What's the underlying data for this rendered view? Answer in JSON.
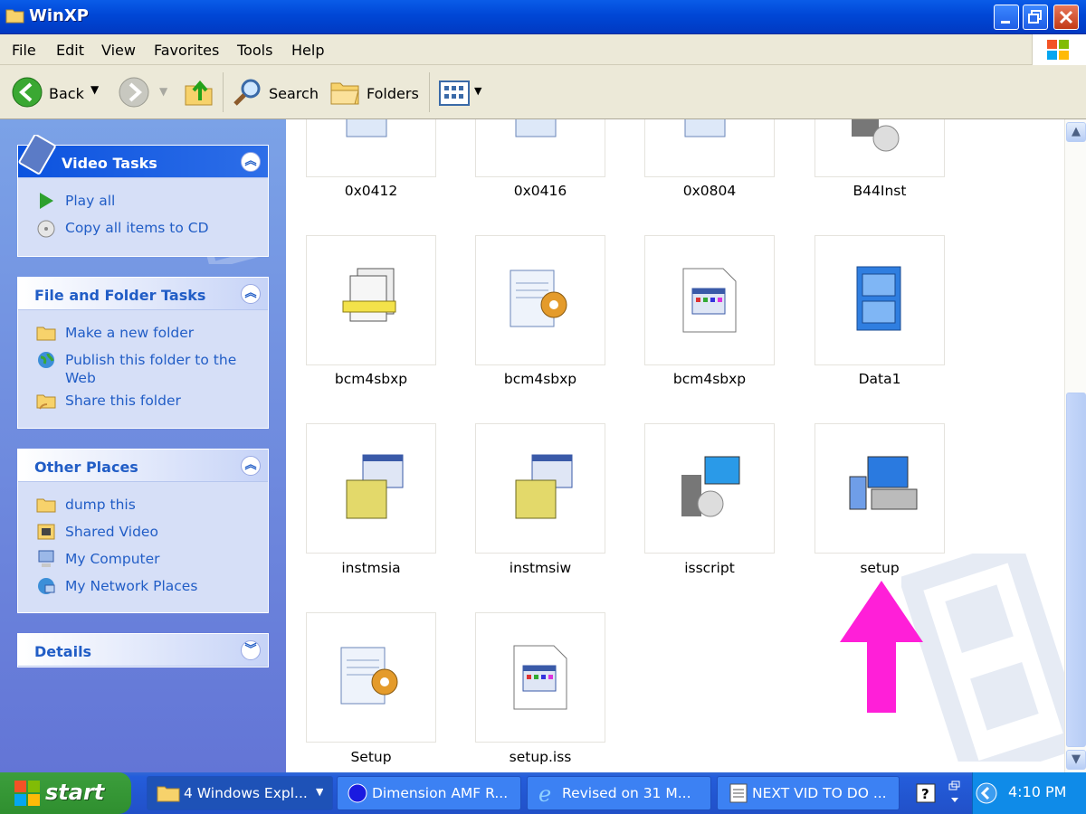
{
  "window": {
    "title": "WinXP"
  },
  "menu": [
    "File",
    "Edit",
    "View",
    "Favorites",
    "Tools",
    "Help"
  ],
  "toolbar": {
    "back": "Back",
    "search": "Search",
    "folders": "Folders"
  },
  "panels": {
    "video": {
      "title": "Video Tasks",
      "links": [
        "Play all",
        "Copy all items to CD"
      ]
    },
    "file": {
      "title": "File and Folder Tasks",
      "links": [
        "Make a new folder",
        "Publish this folder to the Web",
        "Share this folder"
      ]
    },
    "places": {
      "title": "Other Places",
      "links": [
        "dump this",
        "Shared Video",
        "My Computer",
        "My Network Places"
      ]
    },
    "details": {
      "title": "Details"
    }
  },
  "files": [
    {
      "name": "0x0412",
      "icon": "notepad-gear-icon"
    },
    {
      "name": "0x0416",
      "icon": "notepad-gear-icon"
    },
    {
      "name": "0x0804",
      "icon": "notepad-gear-icon"
    },
    {
      "name": "B44Inst",
      "icon": "cd-setup-icon"
    },
    {
      "name": "bcm4sbxp",
      "icon": "documents-stack-icon"
    },
    {
      "name": "bcm4sbxp",
      "icon": "notepad-gear-icon"
    },
    {
      "name": "bcm4sbxp",
      "icon": "app-file-icon"
    },
    {
      "name": "Data1",
      "icon": "file-cabinet-icon"
    },
    {
      "name": "instmsia",
      "icon": "installer-box-icon"
    },
    {
      "name": "instmsiw",
      "icon": "installer-box-icon"
    },
    {
      "name": "isscript",
      "icon": "cd-computer-icon"
    },
    {
      "name": "setup",
      "icon": "computer-setup-icon"
    },
    {
      "name": "Setup",
      "icon": "notepad-gear-icon"
    },
    {
      "name": "setup.iss",
      "icon": "app-file-icon"
    }
  ],
  "annotation": {
    "color": "#ff1fd8"
  },
  "taskbar": {
    "start": "start",
    "buttons": [
      "4 Windows Expl...",
      "Dimension AMF R...",
      "Revised on 31 M...",
      "NEXT VID TO DO ..."
    ],
    "clock": "4:10 PM"
  }
}
